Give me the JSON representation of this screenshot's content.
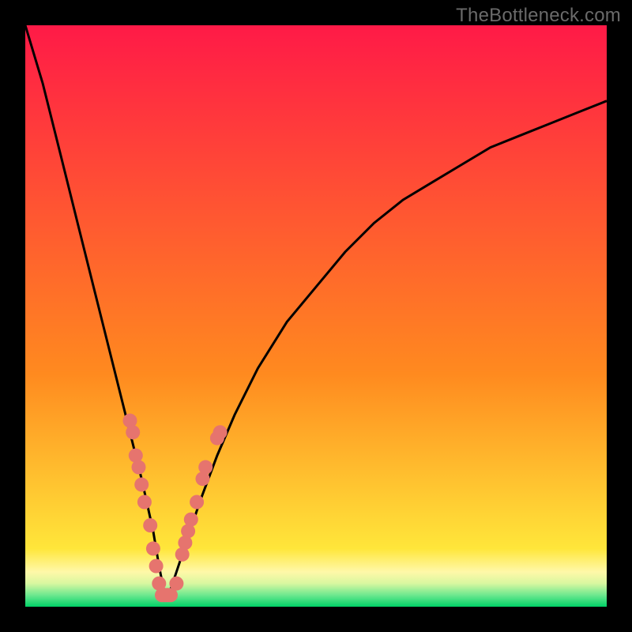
{
  "watermark": "TheBottleneck.com",
  "chart_data": {
    "type": "line",
    "title": "",
    "xlabel": "",
    "ylabel": "",
    "xlim": [
      0,
      100
    ],
    "ylim": [
      0,
      100
    ],
    "x_min_point": 24,
    "series": [
      {
        "name": "curve",
        "x": [
          0,
          3,
          6,
          9,
          12,
          15,
          18,
          20,
          22,
          23,
          24,
          25,
          26,
          28,
          30,
          33,
          36,
          40,
          45,
          50,
          55,
          60,
          65,
          70,
          75,
          80,
          85,
          90,
          95,
          100
        ],
        "y": [
          100,
          90,
          78,
          66,
          54,
          42,
          30,
          22,
          13,
          7,
          2,
          3,
          6,
          12,
          18,
          26,
          33,
          41,
          49,
          55,
          61,
          66,
          70,
          73,
          76,
          79,
          81,
          83,
          85,
          87
        ]
      }
    ],
    "markers": {
      "name": "data-points",
      "color": "#e6746e",
      "points": [
        {
          "x": 18.0,
          "y": 32
        },
        {
          "x": 18.5,
          "y": 30
        },
        {
          "x": 19.0,
          "y": 26
        },
        {
          "x": 19.5,
          "y": 24
        },
        {
          "x": 20.0,
          "y": 21
        },
        {
          "x": 20.5,
          "y": 18
        },
        {
          "x": 21.5,
          "y": 14
        },
        {
          "x": 22.0,
          "y": 10
        },
        {
          "x": 22.5,
          "y": 7
        },
        {
          "x": 23.0,
          "y": 4
        },
        {
          "x": 23.5,
          "y": 2
        },
        {
          "x": 24.0,
          "y": 2
        },
        {
          "x": 24.5,
          "y": 2
        },
        {
          "x": 25.0,
          "y": 2
        },
        {
          "x": 26.0,
          "y": 4
        },
        {
          "x": 27.0,
          "y": 9
        },
        {
          "x": 27.5,
          "y": 11
        },
        {
          "x": 28.0,
          "y": 13
        },
        {
          "x": 28.5,
          "y": 15
        },
        {
          "x": 29.5,
          "y": 18
        },
        {
          "x": 30.5,
          "y": 22
        },
        {
          "x": 31.0,
          "y": 24
        },
        {
          "x": 33.0,
          "y": 29
        },
        {
          "x": 33.5,
          "y": 30
        }
      ]
    },
    "gradient_bands": [
      {
        "y0": 100,
        "y1": 40,
        "from": "#ff1a47",
        "to": "#ff8a1f"
      },
      {
        "y0": 40,
        "y1": 10,
        "from": "#ff8a1f",
        "to": "#ffe63a"
      },
      {
        "y0": 10,
        "y1": 6,
        "from": "#ffe63a",
        "to": "#fff8a8"
      },
      {
        "y0": 6,
        "y1": 4,
        "from": "#fff8a8",
        "to": "#d8f7a0"
      },
      {
        "y0": 4,
        "y1": 2,
        "from": "#d8f7a0",
        "to": "#6de88f"
      },
      {
        "y0": 2,
        "y1": 0,
        "from": "#6de88f",
        "to": "#00d267"
      }
    ]
  }
}
